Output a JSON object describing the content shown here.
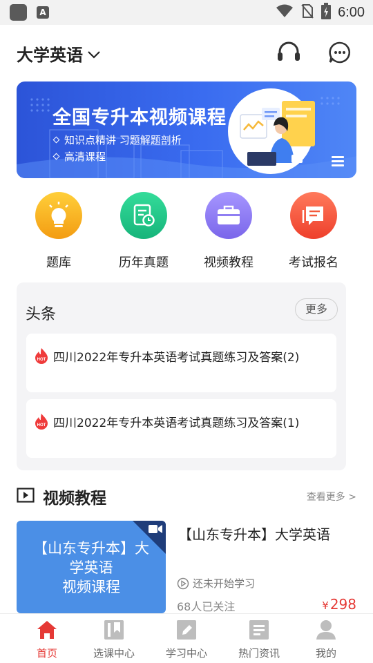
{
  "status_bar": {
    "time": "6:00",
    "icons": [
      "app-icon",
      "a-icon",
      "wifi-icon",
      "no-sim-icon",
      "battery-charging-icon"
    ]
  },
  "header": {
    "title": "大学英语",
    "icons": [
      "chevron-down-icon",
      "headset-icon",
      "chat-icon"
    ]
  },
  "banner": {
    "title": "全国专升本视频课程",
    "line1": "知识点精讲 习题解题剖析",
    "line2": "高清课程",
    "colors": {
      "start": "#2c54d8",
      "end": "#4f86f6"
    }
  },
  "quick_nav": [
    {
      "label": "题库",
      "icon": "lightbulb-icon",
      "color": "#f6a623"
    },
    {
      "label": "历年真题",
      "icon": "calendar-doc-icon",
      "color": "#27c989"
    },
    {
      "label": "视频教程",
      "icon": "briefcase-icon",
      "color": "#8a79f0"
    },
    {
      "label": "考试报名",
      "icon": "message-list-icon",
      "color": "#f35a3b"
    }
  ],
  "headlines": {
    "title": "头条",
    "more_label": "更多",
    "items": [
      {
        "badge": "HOT",
        "text": "四川2022年专升本英语考试真题练习及答案(2)"
      },
      {
        "badge": "HOT",
        "text": "四川2022年专升本英语考试真题练习及答案(1)"
      }
    ]
  },
  "video_section": {
    "title": "视频教程",
    "more_label": "查看更多 >",
    "course": {
      "thumb_line1": "【山东专升本】大",
      "thumb_line2": "学英语",
      "thumb_line3": "视频课程",
      "title": "【山东专升本】大学英语",
      "status": "还未开始学习",
      "followers": "68人已关注",
      "currency": "¥",
      "price": "298"
    }
  },
  "bottom_nav": [
    {
      "label": "首页",
      "icon": "home-icon",
      "active": true
    },
    {
      "label": "选课中心",
      "icon": "bookmark-book-icon",
      "active": false
    },
    {
      "label": "学习中心",
      "icon": "edit-pen-icon",
      "active": false
    },
    {
      "label": "热门资讯",
      "icon": "document-lines-icon",
      "active": false
    },
    {
      "label": "我的",
      "icon": "user-icon",
      "active": false
    }
  ],
  "colors": {
    "accent_red": "#e53935",
    "card_bg": "#f4f4f6"
  }
}
